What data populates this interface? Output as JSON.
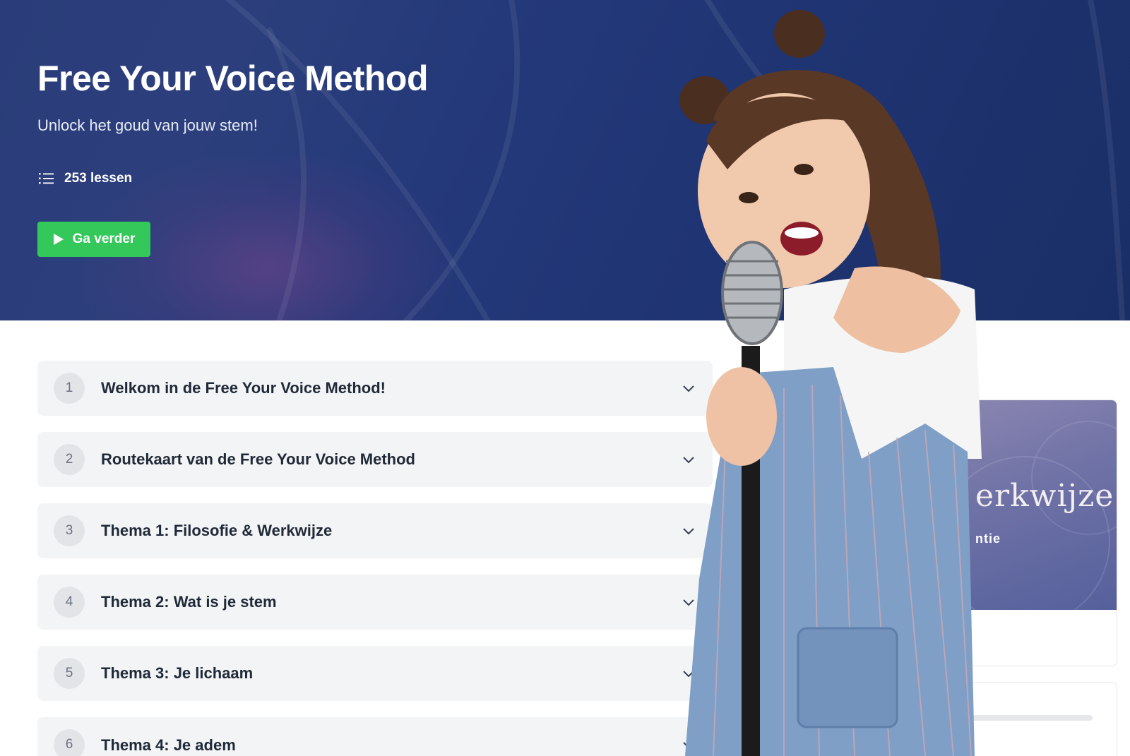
{
  "course": {
    "title": "Free Your Voice Method",
    "subtitle": "Unlock het goud van jouw stem!",
    "lesson_count": "253 lessen",
    "continue_label": "Ga verder"
  },
  "modules": [
    {
      "number": "1",
      "title": "Welkom in de Free Your Voice Method!"
    },
    {
      "number": "2",
      "title": "Routekaart van de Free Your Voice Method"
    },
    {
      "number": "3",
      "title": "Thema 1: Filosofie & Werkwijze"
    },
    {
      "number": "4",
      "title": "Thema 2: Wat is je stem"
    },
    {
      "number": "5",
      "title": "Thema 3: Je lichaam"
    },
    {
      "number": "6",
      "title": "Thema 4: Je adem"
    }
  ],
  "side_card": {
    "heading_fragment": "erkwijze",
    "sub_fragment": "ntie"
  },
  "colors": {
    "hero_bg": "#24397a",
    "accent_green": "#34c759",
    "module_bg": "#f3f4f6"
  }
}
